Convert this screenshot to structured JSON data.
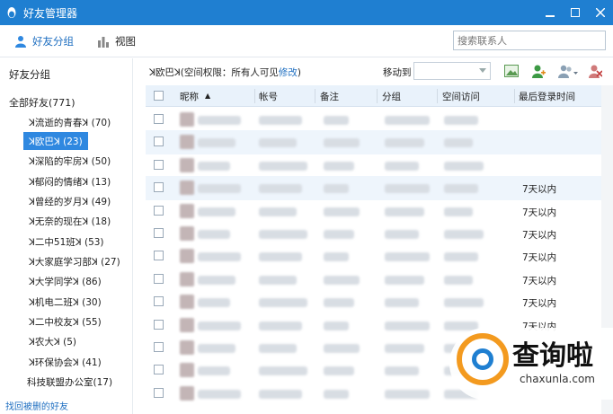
{
  "window": {
    "title": "好友管理器"
  },
  "toolbar": {
    "friends_group_label": "好友分组",
    "view_label": "视图"
  },
  "search": {
    "placeholder": "搜索联系人"
  },
  "sidebar": {
    "heading": "好友分组",
    "all_friends": "全部好友(771)",
    "groups": [
      {
        "label": "ꓘ流逝的青春ꓘ (70)",
        "selected": false
      },
      {
        "label": "ꓘ欧巴ꓘ (23)",
        "selected": true
      },
      {
        "label": "ꓘ深陷的牢房ꓘ (50)",
        "selected": false
      },
      {
        "label": "ꓘ郁闷的情绪ꓘ (13)",
        "selected": false
      },
      {
        "label": "ꓘ曾经的岁月ꓘ (49)",
        "selected": false
      },
      {
        "label": "ꓘ无奈的现在ꓘ (18)",
        "selected": false
      },
      {
        "label": "ꓘ二中51班ꓘ (53)",
        "selected": false
      },
      {
        "label": "ꓘ大家庭学习部ꓘ (27)",
        "selected": false
      },
      {
        "label": "ꓘ大学同学ꓘ (86)",
        "selected": false
      },
      {
        "label": "ꓘ机电二班ꓘ (30)",
        "selected": false
      },
      {
        "label": "ꓘ二中校友ꓘ (55)",
        "selected": false
      },
      {
        "label": "ꓘ农大ꓘ (5)",
        "selected": false
      },
      {
        "label": "ꓘ环保协会ꓘ (41)",
        "selected": false
      },
      {
        "label": "科技联盟办公室(17)",
        "selected": false
      }
    ],
    "footer_link": "找回被删的好友"
  },
  "pathbar": {
    "path_prefix": "ꓘ欧巴ꓘ",
    "permission_text": "(空间权限：所有人可见",
    "modify_link": "修改",
    "close_paren": ")",
    "move_to_label": "移动到"
  },
  "table": {
    "headers": [
      "昵称",
      "帐号",
      "备注",
      "分组",
      "空间访问",
      "最后登录时间"
    ],
    "sort_indicator": "▲",
    "rows": [
      {
        "login": "",
        "alt": false
      },
      {
        "login": "",
        "alt": true
      },
      {
        "login": "",
        "alt": false
      },
      {
        "login": "7天以内",
        "alt": true
      },
      {
        "login": "7天以内",
        "alt": false
      },
      {
        "login": "7天以内",
        "alt": false
      },
      {
        "login": "7天以内",
        "alt": false
      },
      {
        "login": "7天以内",
        "alt": false
      },
      {
        "login": "7天以内",
        "alt": false
      },
      {
        "login": "7天以内",
        "alt": false
      },
      {
        "login": "",
        "alt": false
      },
      {
        "login": "",
        "alt": false
      },
      {
        "login": "",
        "alt": false
      }
    ]
  },
  "watermark": {
    "big": "查询啦",
    "small": "chaxunla.com"
  },
  "colors": {
    "titlebar": "#1f7fd1",
    "selection": "#2f88e0",
    "link": "#1f6fc1"
  }
}
